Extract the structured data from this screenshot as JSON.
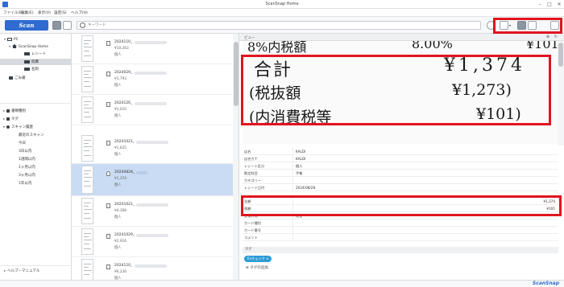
{
  "window": {
    "title": "ScanSnap Home"
  },
  "menu": [
    "ファイル(E)",
    "編集(E)",
    "表示(V)",
    "設定(S)",
    "ヘルプ(H)"
  ],
  "toolbar": {
    "scan_label": "Scan",
    "search_placeholder": "キーワード"
  },
  "sidebar": {
    "pc_label": "PC",
    "home_label": "ScanSnap Home",
    "folders": [
      "レシート",
      "経費",
      "名刺"
    ],
    "other_label": "ごみ箱",
    "sections": [
      "書類種別",
      "タグ",
      "スキャン履歴"
    ],
    "history": [
      "最近のスキャン",
      "今日",
      "3日以内",
      "1週間以内",
      "1ヶ月以内",
      "3ヶ月以内",
      "1年以内"
    ],
    "help_label": "ヘルプ・マニュアル"
  },
  "list": {
    "items": [
      {
        "name": "2024110_",
        "amount": "¥10,263",
        "person": "個人"
      },
      {
        "name": "2024029_",
        "amount": "¥1,793",
        "person": "個人"
      },
      {
        "name": "2024126_",
        "amount": "¥1,010",
        "person": "個人"
      },
      {
        "name": "20241021_",
        "amount": "¥1,625",
        "person": "個人"
      },
      {
        "name": "20240828_",
        "amount": "¥1,374",
        "person": "個人"
      },
      {
        "name": "20241021_",
        "amount": "¥4,308",
        "person": "個人"
      },
      {
        "name": "20241029_",
        "amount": "¥2,916",
        "person": "個人"
      },
      {
        "name": "2024110_",
        "amount": "¥6,226",
        "person": "個人"
      }
    ]
  },
  "preview": {
    "header_label": "ビュー",
    "receipt": {
      "top_partial_left": "8%内税額",
      "top_partial_mid": "8.00%",
      "top_partial_right": "¥101",
      "total_label": "合計",
      "total_value": "¥1,374",
      "excl_label": "(税抜額",
      "excl_value": "¥1,273)",
      "tax_label": "(内消費税等",
      "tax_value": "¥101)"
    },
    "meta": [
      {
        "k": "店名",
        "v": "KALDI"
      },
      {
        "k": "店名カナ",
        "v": "KALDI"
      },
      {
        "k": "レシート区分",
        "v": "個人"
      },
      {
        "k": "勘定科目",
        "v": "手帳"
      },
      {
        "k": "カテゴリー",
        "v": ""
      },
      {
        "k": "レシート日付",
        "v": "2024/08/28"
      }
    ],
    "amounts": [
      {
        "k": "金額",
        "v": "¥1,374"
      },
      {
        "k": "税額",
        "v": "¥101"
      }
    ],
    "meta2": [
      {
        "k": "支払方法",
        "v": "現金"
      },
      {
        "k": "カード種別",
        "v": ""
      },
      {
        "k": "カード番号",
        "v": ""
      },
      {
        "k": "コメント",
        "v": ""
      }
    ],
    "tag_header": "タグ",
    "tag_chip": "Evチェック",
    "add_tag": "タグの追加"
  },
  "brand": "ScanSnap"
}
